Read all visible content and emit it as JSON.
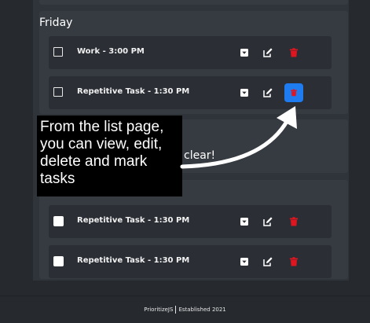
{
  "day": {
    "title": "Friday"
  },
  "friday_tasks": [
    {
      "label": "Work - 3:00 PM",
      "checked": false
    },
    {
      "label": "Repetitive Task - 1:30 PM",
      "checked": false,
      "delete_highlighted": true
    }
  ],
  "next_tasks": [
    {
      "label": "Repetitive Task - 1:30 PM",
      "checked": false
    },
    {
      "label": "Repetitive Task - 1:30 PM",
      "checked": false
    }
  ],
  "hidden_card": {
    "partial_text": "clear!"
  },
  "tooltip": {
    "text": "From the list page,\nyou can view, edit,\ndelete and mark\ntasks"
  },
  "footer": {
    "brand": "PrioritizeJS",
    "established": "Established 2021"
  },
  "colors": {
    "delete": "#e0151f",
    "highlight": "#1e7cf0",
    "background": "#262a2f"
  },
  "icons": {
    "expand": "chevron-down-icon",
    "edit": "edit-icon",
    "delete": "trash-icon"
  }
}
